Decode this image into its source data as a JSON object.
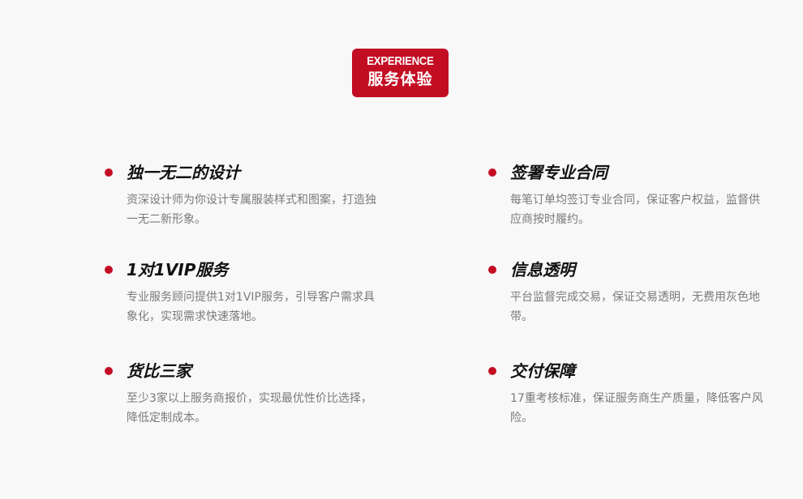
{
  "header": {
    "badge_en": "EXPERIENCE",
    "badge_cn": "服务体验",
    "accent_color": "#c30d23"
  },
  "features": [
    {
      "title": "独一无二的设计",
      "description": "资深设计师为你设计专属服装样式和图案，打造独一无二新形象。"
    },
    {
      "title": "签署专业合同",
      "description": "每笔订单均签订专业合同，保证客户权益，监督供应商按时履约。"
    },
    {
      "title": "1对1VIP服务",
      "description": "专业服务顾问提供1对1VIP服务，引导客户需求具象化，实现需求快速落地。"
    },
    {
      "title": "信息透明",
      "description": "平台监督完成交易，保证交易透明，无费用灰色地带。"
    },
    {
      "title": "货比三家",
      "description": "至少3家以上服务商报价，实现最优性价比选择，降低定制成本。"
    },
    {
      "title": "交付保障",
      "description": "17重考核标准，保证服务商生产质量，降低客户风险。"
    }
  ]
}
